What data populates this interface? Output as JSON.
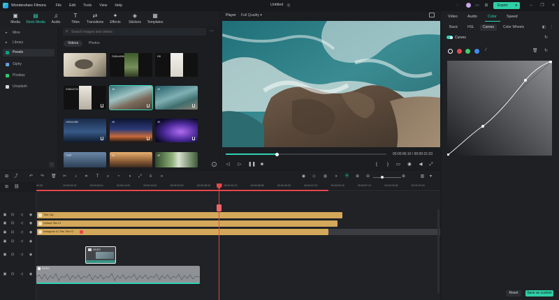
{
  "titlebar": {
    "app_name": "Wondershare Filmora",
    "menus": [
      "File",
      "Edit",
      "Tools",
      "View",
      "Help"
    ],
    "doc_title": "Untitled",
    "export_label": "Export"
  },
  "media_tabs": [
    {
      "label": "Media",
      "icon": "media-icon"
    },
    {
      "label": "Stock Media",
      "icon": "stock-media-icon",
      "active": true
    },
    {
      "label": "Audio",
      "icon": "audio-icon"
    },
    {
      "label": "Titles",
      "icon": "titles-icon"
    },
    {
      "label": "Transitions",
      "icon": "transitions-icon"
    },
    {
      "label": "Effects",
      "icon": "effects-icon"
    },
    {
      "label": "Stickers",
      "icon": "stickers-icon"
    },
    {
      "label": "Templates",
      "icon": "templates-icon"
    }
  ],
  "sidebar": {
    "items": [
      {
        "label": "Mine",
        "icon": "chevron-right-icon"
      },
      {
        "label": "Library",
        "icon": "chevron-right-icon"
      },
      {
        "label": "Pexels",
        "icon": "pexels-icon",
        "active": true
      },
      {
        "label": "Giphy",
        "icon": "giphy-icon"
      },
      {
        "label": "Pixabay",
        "icon": "pixabay-icon"
      },
      {
        "label": "Unsplash",
        "icon": "unsplash-icon"
      }
    ]
  },
  "search": {
    "placeholder": "Search images and videos"
  },
  "content_tabs": [
    "Videos",
    "Photos"
  ],
  "thumbnails": [
    {
      "tag": "",
      "selected": false
    },
    {
      "tag": "2160x4096",
      "selected": false
    },
    {
      "tag": "HD",
      "selected": false
    },
    {
      "tag": "2160x3744",
      "selected": false
    },
    {
      "tag": "4K",
      "selected": true
    },
    {
      "tag": "4K",
      "selected": false
    },
    {
      "tag": "1920x1080",
      "selected": false
    },
    {
      "tag": "4K",
      "selected": false
    },
    {
      "tag": "4K",
      "selected": false
    },
    {
      "tag": "720P",
      "selected": false
    },
    {
      "tag": "4K",
      "selected": false
    },
    {
      "tag": "4K",
      "selected": false
    }
  ],
  "player": {
    "label": "Player",
    "quality": "Full Quality",
    "progress": 0.32,
    "timecode": "00:00:06:10",
    "separator": "/",
    "duration": "00:00:21:03"
  },
  "right_panel": {
    "tabs": [
      "Video",
      "Audio",
      "Color",
      "Speed"
    ],
    "active_tab": "Color",
    "subtabs": [
      "Basic",
      "HSL",
      "Curves",
      "Color Wheels"
    ],
    "active_subtab": "Curves",
    "curves_label": "Curves",
    "channels": [
      {
        "name": "luma-channel-icon",
        "color": "#ffffff"
      },
      {
        "name": "red-channel-icon",
        "color": "#e5484d"
      },
      {
        "name": "green-channel-icon",
        "color": "#3fcf6a"
      },
      {
        "name": "blue-channel-icon",
        "color": "#3f8cf0"
      }
    ],
    "reset_label": "Reset",
    "save_label": "Save as custom"
  },
  "timeline": {
    "ruler_ticks": [
      "00:00",
      "00:00:04:19",
      "00:00:09:14",
      "00:00:14:09",
      "00:00:19:04",
      "00:00:23:23",
      "00:00:28:18",
      "00:00:33:13",
      "00:00:38:08",
      "00:00:43:03",
      "00:00:47:23",
      "00:00:52:18",
      "00:00:57:13",
      "00:01:02:08",
      "00:01:07:03"
    ],
    "clips": [
      {
        "label": "Title Clip"
      },
      {
        "label": "Default Title 01"
      },
      {
        "label": "Instagram 01 Title Title 02"
      }
    ],
    "video_clip_label": "VIDEO",
    "audio_clip_label": "VIDEO",
    "accent": "#d4a85a",
    "playhead_color": "#e5484d"
  }
}
